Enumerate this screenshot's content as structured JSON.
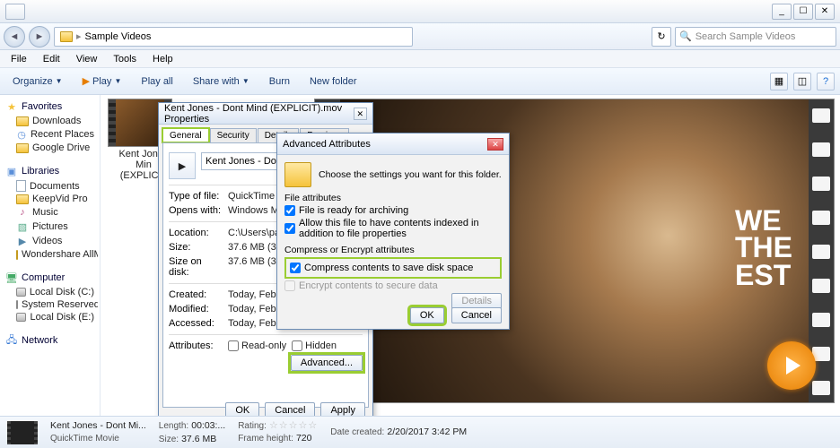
{
  "window": {
    "breadcrumb": "Sample Videos",
    "search_placeholder": "Search Sample Videos"
  },
  "menu": {
    "file": "File",
    "edit": "Edit",
    "view": "View",
    "tools": "Tools",
    "help": "Help"
  },
  "toolbar": {
    "organize": "Organize",
    "play": "Play",
    "play_all": "Play all",
    "share_with": "Share with",
    "burn": "Burn",
    "new_folder": "New folder"
  },
  "sidebar": {
    "favorites": {
      "head": "Favorites",
      "items": [
        "Downloads",
        "Recent Places",
        "Google Drive"
      ]
    },
    "libraries": {
      "head": "Libraries",
      "items": [
        "Documents",
        "KeepVid Pro",
        "Music",
        "Pictures",
        "Videos",
        "Wondershare AllMy"
      ]
    },
    "computer": {
      "head": "Computer",
      "items": [
        "Local Disk (C:)",
        "System Reserved (D:)",
        "Local Disk (E:)"
      ]
    },
    "network": {
      "head": "Network"
    }
  },
  "thumb": {
    "line1": "Kent Jones",
    "line2": "Min",
    "line3": "(EXPLICIT"
  },
  "preview_text": "WE\nTHE\nEST",
  "properties": {
    "title": "Kent Jones - Dont Mind (EXPLICIT).mov Properties",
    "tabs": {
      "general": "General",
      "security": "Security",
      "details": "Details",
      "previous": "Previous"
    },
    "filename": "Kent Jones - Dont Min",
    "type_label": "Type of file:",
    "type_value": "QuickTime Movie (.mov",
    "opens_label": "Opens with:",
    "opens_value": "Windows Media Pl",
    "location_label": "Location:",
    "location_value": "C:\\Users\\payal\\Deskto",
    "size_label": "Size:",
    "size_value": "37.6 MB (39,529,931 b",
    "sizeondisk_label": "Size on disk:",
    "sizeondisk_value": "37.6 MB (39,530,496 by",
    "created_label": "Created:",
    "created_value": "Today, February 20, 201",
    "modified_label": "Modified:",
    "modified_value": "Today, February 20, 201",
    "accessed_label": "Accessed:",
    "accessed_value": "Today, February 20, 2017",
    "attributes_label": "Attributes:",
    "readonly": "Read-only",
    "hidden": "Hidden",
    "advanced": "Advanced...",
    "ok": "OK",
    "cancel": "Cancel",
    "apply": "Apply"
  },
  "advanced": {
    "title": "Advanced Attributes",
    "choose": "Choose the settings you want for this folder.",
    "file_attributes": "File attributes",
    "ready": "File is ready for archiving",
    "index": "Allow this file to have contents indexed in addition to file properties",
    "compress_head": "Compress or Encrypt attributes",
    "compress": "Compress contents to save disk space",
    "encrypt": "Encrypt contents to secure data",
    "details": "Details",
    "ok": "OK",
    "cancel": "Cancel"
  },
  "status": {
    "name": "Kent Jones - Dont Mi...",
    "type": "QuickTime Movie",
    "length_label": "Length:",
    "length_value": "00:03:...",
    "size_label": "Size:",
    "size_value": "37.6 MB",
    "rating_label": "Rating:",
    "frameh_label": "Frame height:",
    "frameh_value": "720",
    "date_label": "Date created:",
    "date_value": "2/20/2017 3:42 PM"
  }
}
